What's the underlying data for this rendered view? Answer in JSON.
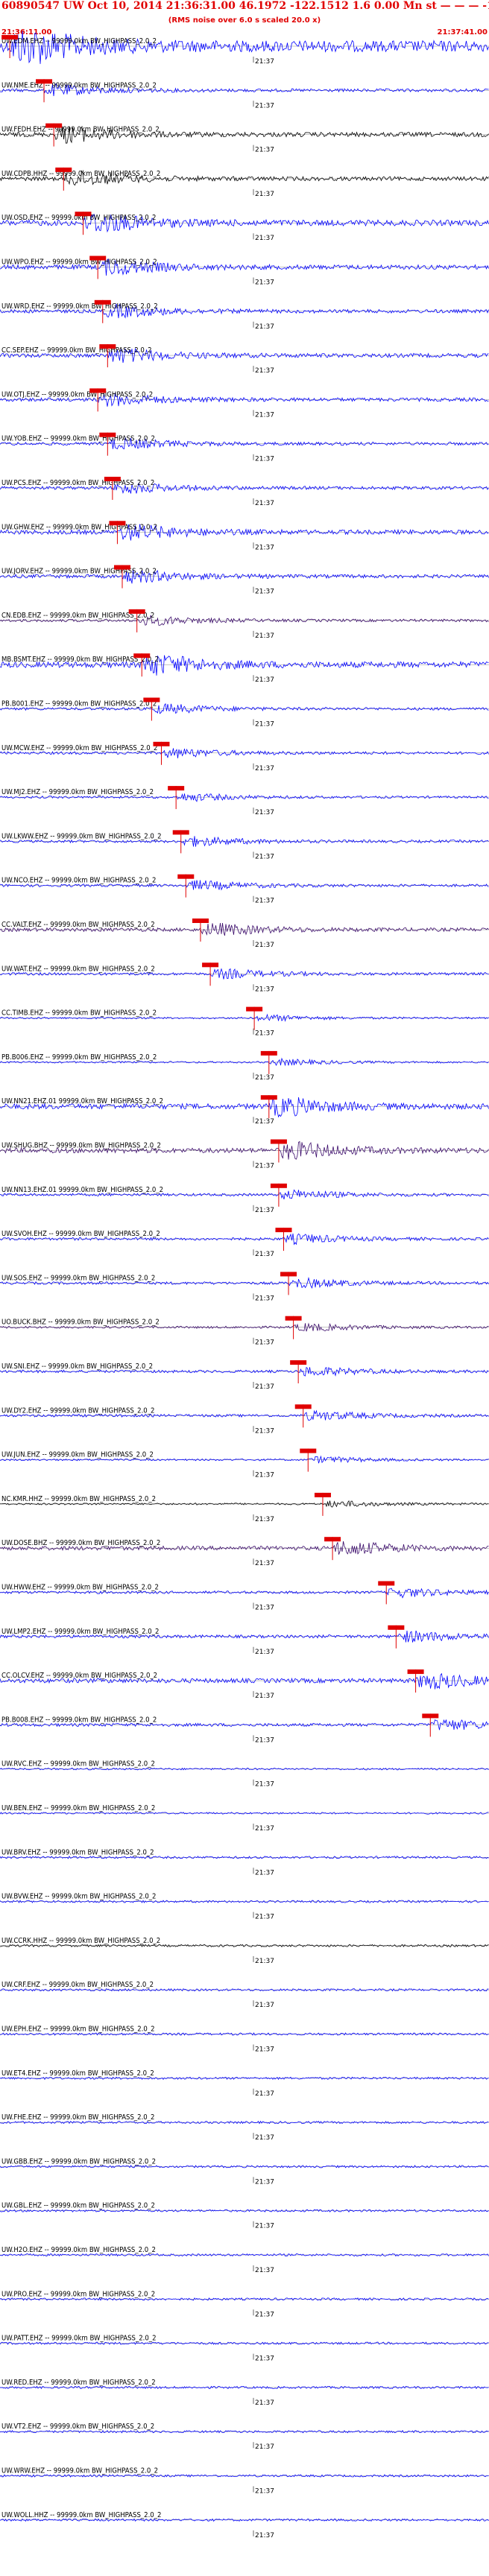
{
  "header": {
    "line1": "60890547 UW Oct 10, 2014 21:36:31.00   46.1972  -122.1512  1.6 0.00 Mn st — — —  -1",
    "line2": "(RMS noise over 6.0 s scaled 20.0 x)",
    "start_time": "21:36:11.00",
    "end_time": "21:37:41.00"
  },
  "chart_data": {
    "type": "seismogram-record-section",
    "time_window": [
      "21:36:11.00",
      "21:37:41.00"
    ],
    "minute_tick_label": "21:37",
    "pick_color": "#e00000",
    "trace_colors": [
      "#0000ff",
      "#000000",
      "#3a0a6a"
    ],
    "traces": [
      {
        "label": "UW.EDM.EHZ -- 99999.0km BW_HIGHPASS_2.0_2",
        "pick": 0.02,
        "amp": 2.5,
        "color": "#0000ff"
      },
      {
        "label": "UW.NME.EHZ -- 99999.0km BW_HIGHPASS_2.0_2",
        "pick": 0.09,
        "amp": 0.7,
        "color": "#0000ff"
      },
      {
        "label": "UW.FEDH.EHZ -- 99999.0km BW_HIGHPASS_2.0_2",
        "pick": 0.11,
        "amp": 1.0,
        "color": "#000000"
      },
      {
        "label": "UW.CDPB.HHZ -- 99999.0km BW_HIGHPASS_2.0_2",
        "pick": 0.13,
        "amp": 0.9,
        "color": "#000000"
      },
      {
        "label": "UW.OSD.EHZ -- 99999.0km BW_HIGHPASS_2.0_2",
        "pick": 0.17,
        "amp": 1.3,
        "color": "#0000ff"
      },
      {
        "label": "UW.WPO.EHZ -- 99999.0km BW_HIGHPASS_2.0_2",
        "pick": 0.2,
        "amp": 1.0,
        "color": "#0000ff"
      },
      {
        "label": "UW.WRD.EHZ -- 99999.0km BW_HIGHPASS_2.0_2",
        "pick": 0.21,
        "amp": 0.8,
        "color": "#0000ff"
      },
      {
        "label": "CC.SEP.EHZ -- 99999.0km BW_HIGHPASS_2.0_2",
        "pick": 0.22,
        "amp": 0.9,
        "color": "#0000ff"
      },
      {
        "label": "UW.OTJ.EHZ -- 99999.0km BW_HIGHPASS_2.0_2",
        "pick": 0.2,
        "amp": 0.8,
        "color": "#0000ff"
      },
      {
        "label": "UW.YOB.EHZ -- 99999.0km BW_HIGHPASS_2.0_2",
        "pick": 0.22,
        "amp": 0.7,
        "color": "#0000ff"
      },
      {
        "label": "UW.PCS.EHZ -- 99999.0km BW_HIGHPASS_2.0_2",
        "pick": 0.23,
        "amp": 0.7,
        "color": "#0000ff"
      },
      {
        "label": "UW.GHW.EHZ -- 99999.0km BW_HIGHPASS_2.0_2",
        "pick": 0.24,
        "amp": 1.0,
        "color": "#0000ff"
      },
      {
        "label": "UW.JORV.EHZ -- 99999.0km BW_HIGHPASS_2.0_2",
        "pick": 0.25,
        "amp": 0.8,
        "color": "#0000ff"
      },
      {
        "label": "CN.EDB.EHZ -- 99999.0km BW_HIGHPASS_2.0_2",
        "pick": 0.28,
        "amp": 0.6,
        "color": "#3a0a6a"
      },
      {
        "label": "MB.BSMT.EHZ -- 99999.0km BW_HIGHPASS_2.0_2",
        "pick": 0.29,
        "amp": 1.3,
        "color": "#0000ff"
      },
      {
        "label": "PB.B001.EHZ -- 99999.0km BW_HIGHPASS_2.0_2",
        "pick": 0.31,
        "amp": 0.6,
        "color": "#0000ff"
      },
      {
        "label": "UW.MCW.EHZ -- 99999.0km BW_HIGHPASS_2.0_2",
        "pick": 0.33,
        "amp": 0.6,
        "color": "#0000ff"
      },
      {
        "label": "UW.MJ2.EHZ -- 99999.0km BW_HIGHPASS_2.0_2",
        "pick": 0.36,
        "amp": 0.5,
        "color": "#0000ff"
      },
      {
        "label": "UW.LKWW.EHZ -- 99999.0km BW_HIGHPASS_2.0_2",
        "pick": 0.37,
        "amp": 0.6,
        "color": "#0000ff"
      },
      {
        "label": "UW.NCO.EHZ -- 99999.0km BW_HIGHPASS_2.0_2",
        "pick": 0.38,
        "amp": 0.6,
        "color": "#0000ff"
      },
      {
        "label": "CC.VALT.EHZ -- 99999.0km BW_HIGHPASS_2.0_2",
        "pick": 0.41,
        "amp": 0.8,
        "color": "#3a0a6a"
      },
      {
        "label": "UW.WAT.EHZ -- 99999.0km BW_HIGHPASS_2.0_2",
        "pick": 0.43,
        "amp": 0.6,
        "color": "#0000ff"
      },
      {
        "label": "CC.TIMB.EHZ -- 99999.0km BW_HIGHPASS_2.0_2",
        "pick": 0.52,
        "amp": 0.4,
        "color": "#0000ff"
      },
      {
        "label": "PB.B006.EHZ -- 99999.0km BW_HIGHPASS_2.0_2",
        "pick": 0.55,
        "amp": 0.4,
        "color": "#0000ff"
      },
      {
        "label": "UW.NN21.EHZ.01 99999.0km BW_HIGHPASS_2.0_2",
        "pick": 0.55,
        "amp": 1.2,
        "color": "#0000ff"
      },
      {
        "label": "UW.SHUG.BHZ -- 99999.0km BW_HIGHPASS_2.0_2",
        "pick": 0.57,
        "amp": 1.1,
        "color": "#3a0a6a"
      },
      {
        "label": "UW.NN13.EHZ.01 99999.0km BW_HIGHPASS_2.0_2",
        "pick": 0.57,
        "amp": 0.6,
        "color": "#0000ff"
      },
      {
        "label": "UW.SVOH.EHZ -- 99999.0km BW_HIGHPASS_2.0_2",
        "pick": 0.58,
        "amp": 0.6,
        "color": "#0000ff"
      },
      {
        "label": "UW.SOS.EHZ -- 99999.0km BW_HIGHPASS_2.0_2",
        "pick": 0.59,
        "amp": 0.6,
        "color": "#0000ff"
      },
      {
        "label": "UO.BUCK.BHZ -- 99999.0km BW_HIGHPASS_2.0_2",
        "pick": 0.6,
        "amp": 0.5,
        "color": "#3a0a6a"
      },
      {
        "label": "UW.SNI.EHZ -- 99999.0km BW_HIGHPASS_2.0_2",
        "pick": 0.61,
        "amp": 0.6,
        "color": "#0000ff"
      },
      {
        "label": "UW.DY2.EHZ -- 99999.0km BW_HIGHPASS_2.0_2",
        "pick": 0.62,
        "amp": 0.6,
        "color": "#0000ff"
      },
      {
        "label": "UW.JUN.EHZ -- 99999.0km BW_HIGHPASS_2.0_2",
        "pick": 0.63,
        "amp": 0.4,
        "color": "#0000ff"
      },
      {
        "label": "NC.KMR.HHZ -- 99999.0km BW_HIGHPASS_2.0_2",
        "pick": 0.66,
        "amp": 0.4,
        "color": "#000000"
      },
      {
        "label": "UW.DOSE.BHZ -- 99999.0km BW_HIGHPASS_2.0_2",
        "pick": 0.68,
        "amp": 0.9,
        "color": "#3a0a6a"
      },
      {
        "label": "UW.HWW.EHZ -- 99999.0km BW_HIGHPASS_2.0_2",
        "pick": 0.79,
        "amp": 0.6,
        "color": "#0000ff"
      },
      {
        "label": "UW.LMP2.EHZ -- 99999.0km BW_HIGHPASS_2.0_2",
        "pick": 0.81,
        "amp": 0.7,
        "color": "#0000ff"
      },
      {
        "label": "CC.OLCV.EHZ -- 99999.0km BW_HIGHPASS_2.0_2",
        "pick": 0.85,
        "amp": 1.0,
        "color": "#0000ff"
      },
      {
        "label": "PB.B008.EHZ -- 99999.0km BW_HIGHPASS_2.0_2",
        "pick": 0.88,
        "amp": 0.7,
        "color": "#0000ff"
      },
      {
        "label": "UW.RVC.EHZ -- 99999.0km BW_HIGHPASS_2.0_2",
        "pick": null,
        "amp": 0.4,
        "color": "#0000ff"
      },
      {
        "label": "UW.BEN.EHZ -- 99999.0km BW_HIGHPASS_2.0_2",
        "pick": null,
        "amp": 0.4,
        "color": "#0000ff"
      },
      {
        "label": "UW.BRV.EHZ -- 99999.0km BW_HIGHPASS_2.0_2",
        "pick": null,
        "amp": 0.5,
        "color": "#0000ff"
      },
      {
        "label": "UW.BVW.EHZ -- 99999.0km BW_HIGHPASS_2.0_2",
        "pick": null,
        "amp": 0.5,
        "color": "#0000ff"
      },
      {
        "label": "UW.CCRK.HHZ -- 99999.0km BW_HIGHPASS_2.0_2",
        "pick": null,
        "amp": 0.5,
        "color": "#000000"
      },
      {
        "label": "UW.CRF.EHZ -- 99999.0km BW_HIGHPASS_2.0_2",
        "pick": null,
        "amp": 0.5,
        "color": "#0000ff"
      },
      {
        "label": "UW.EPH.EHZ -- 99999.0km BW_HIGHPASS_2.0_2",
        "pick": null,
        "amp": 0.5,
        "color": "#0000ff"
      },
      {
        "label": "UW.ET4.EHZ -- 99999.0km BW_HIGHPASS_2.0_2",
        "pick": null,
        "amp": 0.5,
        "color": "#0000ff"
      },
      {
        "label": "UW.FHE.EHZ -- 99999.0km BW_HIGHPASS_2.0_2",
        "pick": null,
        "amp": 0.5,
        "color": "#0000ff"
      },
      {
        "label": "UW.GBB.EHZ -- 99999.0km BW_HIGHPASS_2.0_2",
        "pick": null,
        "amp": 0.5,
        "color": "#0000ff"
      },
      {
        "label": "UW.GBL.EHZ -- 99999.0km BW_HIGHPASS_2.0_2",
        "pick": null,
        "amp": 0.5,
        "color": "#0000ff"
      },
      {
        "label": "UW.H2O.EHZ -- 99999.0km BW_HIGHPASS_2.0_2",
        "pick": null,
        "amp": 0.5,
        "color": "#0000ff"
      },
      {
        "label": "UW.PRO.EHZ -- 99999.0km BW_HIGHPASS_2.0_2",
        "pick": null,
        "amp": 0.5,
        "color": "#0000ff"
      },
      {
        "label": "UW.PATT.EHZ -- 99999.0km BW_HIGHPASS_2.0_2",
        "pick": null,
        "amp": 0.5,
        "color": "#0000ff"
      },
      {
        "label": "UW.RED.EHZ -- 99999.0km BW_HIGHPASS_2.0_2",
        "pick": null,
        "amp": 0.5,
        "color": "#0000ff"
      },
      {
        "label": "UW.VT2.EHZ -- 99999.0km BW_HIGHPASS_2.0_2",
        "pick": null,
        "amp": 0.5,
        "color": "#0000ff"
      },
      {
        "label": "UW.WRW.EHZ -- 99999.0km BW_HIGHPASS_2.0_2",
        "pick": null,
        "amp": 0.5,
        "color": "#0000ff"
      },
      {
        "label": "UW.WOLL.HHZ -- 99999.0km BW_HIGHPASS_2.0_2",
        "pick": null,
        "amp": 0.5,
        "color": "#0000ff"
      }
    ]
  }
}
